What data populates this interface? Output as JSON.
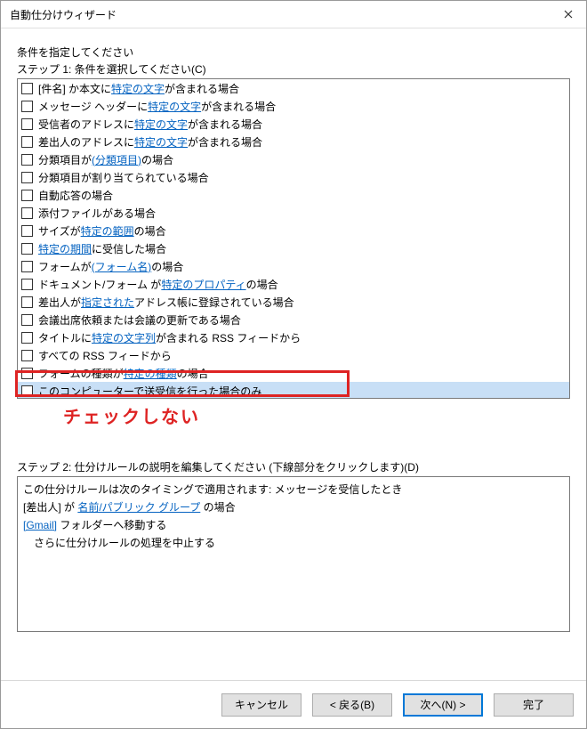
{
  "window": {
    "title": "自動仕分けウィザード"
  },
  "headline": "条件を指定してください",
  "step1_label": "ステップ 1: 条件を選択してください(C)",
  "rows": [
    {
      "parts": [
        {
          "t": "[件名] か本文に "
        },
        {
          "t": "特定の文字",
          "link": true
        },
        {
          "t": " が含まれる場合"
        }
      ]
    },
    {
      "parts": [
        {
          "t": "メッセージ ヘッダーに "
        },
        {
          "t": "特定の文字",
          "link": true
        },
        {
          "t": " が含まれる場合"
        }
      ]
    },
    {
      "parts": [
        {
          "t": "受信者のアドレスに "
        },
        {
          "t": "特定の文字",
          "link": true
        },
        {
          "t": " が含まれる場合"
        }
      ]
    },
    {
      "parts": [
        {
          "t": "差出人のアドレスに "
        },
        {
          "t": "特定の文字",
          "link": true
        },
        {
          "t": " が含まれる場合"
        }
      ]
    },
    {
      "parts": [
        {
          "t": "分類項目が "
        },
        {
          "t": "(分類項目)",
          "link": true
        },
        {
          "t": " の場合"
        }
      ]
    },
    {
      "parts": [
        {
          "t": "分類項目が割り当てられている場合"
        }
      ]
    },
    {
      "parts": [
        {
          "t": "自動応答の場合"
        }
      ]
    },
    {
      "parts": [
        {
          "t": "添付ファイルがある場合"
        }
      ]
    },
    {
      "parts": [
        {
          "t": "サイズが "
        },
        {
          "t": "特定の範囲",
          "link": true
        },
        {
          "t": " の場合"
        }
      ]
    },
    {
      "parts": [
        {
          "t": "特定の期間",
          "link": true
        },
        {
          "t": " に受信した場合"
        }
      ]
    },
    {
      "parts": [
        {
          "t": "フォームが "
        },
        {
          "t": "(フォーム名)",
          "link": true
        },
        {
          "t": " の場合"
        }
      ]
    },
    {
      "parts": [
        {
          "t": "ドキュメント/フォーム が "
        },
        {
          "t": "特定のプロパティ",
          "link": true
        },
        {
          "t": " の場合"
        }
      ]
    },
    {
      "parts": [
        {
          "t": "差出人が "
        },
        {
          "t": "指定された",
          "link": true
        },
        {
          "t": " アドレス帳に登録されている場合"
        }
      ]
    },
    {
      "parts": [
        {
          "t": "会議出席依頼または会議の更新である場合"
        }
      ]
    },
    {
      "parts": [
        {
          "t": "タイトルに "
        },
        {
          "t": "特定の文字列",
          "link": true
        },
        {
          "t": " が含まれる RSS フィードから"
        }
      ]
    },
    {
      "parts": [
        {
          "t": "すべての RSS フィードから"
        }
      ]
    },
    {
      "parts": [
        {
          "t": "フォームの種類が "
        },
        {
          "t": "特定の種類",
          "link": true
        },
        {
          "t": " の場合"
        }
      ]
    },
    {
      "parts": [
        {
          "t": "このコンピューターで送受信を行った場合のみ"
        }
      ],
      "selected": true
    }
  ],
  "annotation": "チェックしない",
  "step2_label": "ステップ 2: 仕分けルールの説明を編集してください (下線部分をクリックします)(D)",
  "desc": {
    "l1a": "この仕分けルールは次のタイミングで適用されます: メッセージを受信したとき",
    "l2a": "[差出人] が ",
    "l2link": "名前/パブリック グループ",
    "l2b": " の場合",
    "l3link": "[Gmail]",
    "l3b": " フォルダーへ移動する",
    "l4": "さらに仕分けルールの処理を中止する"
  },
  "buttons": {
    "cancel": "キャンセル",
    "back": "< 戻る(B)",
    "next": "次へ(N) >",
    "finish": "完了"
  }
}
